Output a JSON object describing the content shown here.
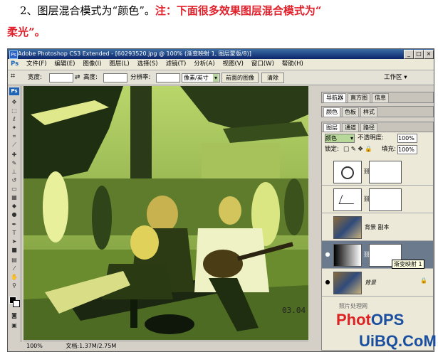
{
  "header": {
    "line1_prefix": "2、图层混合模式为“颜色”。",
    "line1_note": "注：下面很多效果图层混合模式为“",
    "line2": "柔光”。"
  },
  "window": {
    "title": "Adobe Photoshop CS3 Extended - [60293520.jpg @ 100% (渐变映射 1, 图层蒙版/8)]",
    "controls": [
      "_",
      "□",
      "×"
    ]
  },
  "menu": [
    "文件(F)",
    "编辑(E)",
    "图像(I)",
    "图层(L)",
    "选择(S)",
    "滤镜(T)",
    "分析(A)",
    "视图(V)",
    "窗口(W)",
    "帮助(H)"
  ],
  "workspace_label": "工作区 ▾",
  "options_bar": {
    "width_label": "宽度:",
    "height_label": "高度:",
    "resolution_label": "分辨率:",
    "unit_value": "像素/英寸",
    "front_image_button": "前面的图像",
    "clear_button": "清除"
  },
  "status": {
    "zoom": "100%",
    "doc": "文档:1.37M/2.75M"
  },
  "panels": {
    "row1_tabs": [
      "导航器",
      "直方图",
      "信息"
    ],
    "row2_tabs": [
      "颜色",
      "色板",
      "样式"
    ],
    "layers_tabs": [
      "图层",
      "通道",
      "路径"
    ],
    "blend_mode": "颜色",
    "opacity_label": "不透明度:",
    "opacity_value": "100%",
    "lock_label": "锁定:",
    "fill_label": "填充:",
    "fill_value": "100%",
    "layers": [
      {
        "name": ""
      },
      {
        "name": ""
      },
      {
        "name": "背景 副本"
      },
      {
        "name": ""
      },
      {
        "name": "背景"
      }
    ],
    "tooltip": "渐变映射 1"
  },
  "watermark": {
    "small": "照片处理网",
    "brand_a": "Phot",
    "brand_b": "OPS",
    "site": "UiBQ.CoM",
    "stamp": "03.04"
  },
  "colors": {
    "title_bar": "#0a246a",
    "note_red": "#e0202a",
    "canvas_green": "#4d6a2a"
  }
}
